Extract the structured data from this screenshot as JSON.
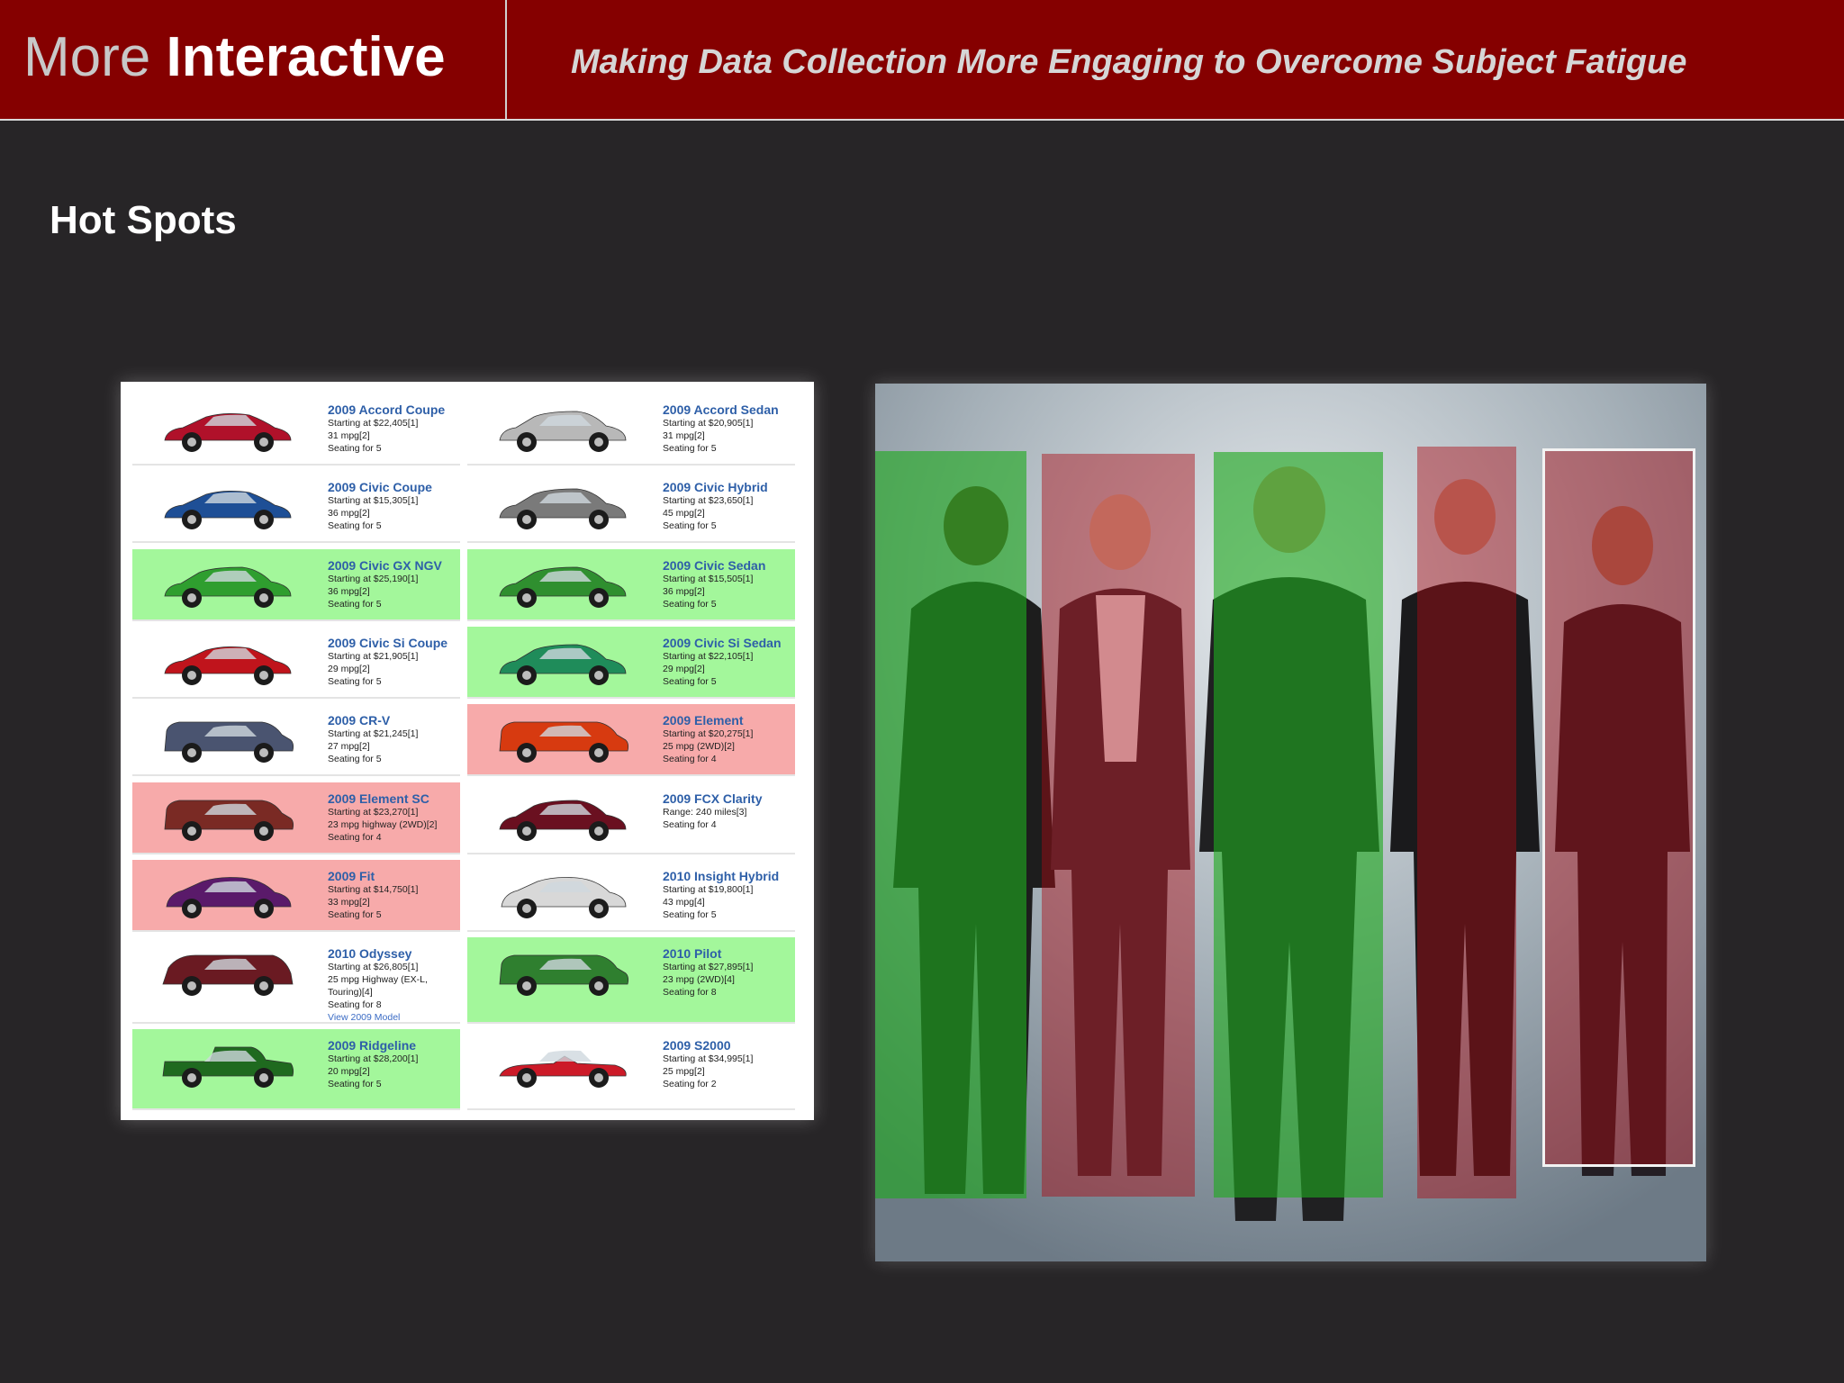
{
  "header": {
    "title_light": "More",
    "title_bold": "Interactive",
    "subtitle": "Making Data Collection More Engaging to Overcome Subject Fatigue"
  },
  "section_title": "Hot Spots",
  "colors": {
    "header_bg": "#850000",
    "page_bg": "#272527",
    "hotspot_green": "#2eaa2e",
    "hotspot_red": "#aa0a14"
  },
  "catalog": {
    "cars": [
      {
        "name": "2009 Accord Coupe",
        "lines": [
          "Starting at $22,405[1]",
          "31 mpg[2]",
          "Seating for 5"
        ],
        "state": "none",
        "color": "#b0112a",
        "type": "coupe"
      },
      {
        "name": "2009 Accord Sedan",
        "lines": [
          "Starting at $20,905[1]",
          "31 mpg[2]",
          "Seating for 5"
        ],
        "state": "none",
        "color": "#b8b8b8",
        "type": "sedan"
      },
      {
        "name": "2009 Civic Coupe",
        "lines": [
          "Starting at $15,305[1]",
          "36 mpg[2]",
          "Seating for 5"
        ],
        "state": "none",
        "color": "#1e4f96",
        "type": "coupe"
      },
      {
        "name": "2009 Civic Hybrid",
        "lines": [
          "Starting at $23,650[1]",
          "45 mpg[2]",
          "Seating for 5"
        ],
        "state": "none",
        "color": "#7a7a7a",
        "type": "sedan"
      },
      {
        "name": "2009 Civic GX NGV",
        "lines": [
          "Starting at $25,190[1]",
          "36 mpg[2]",
          "Seating for 5"
        ],
        "state": "green",
        "color": "#2f9e2f",
        "type": "sedan"
      },
      {
        "name": "2009 Civic Sedan",
        "lines": [
          "Starting at $15,505[1]",
          "36 mpg[2]",
          "Seating for 5"
        ],
        "state": "green",
        "color": "#2f8f2f",
        "type": "sedan"
      },
      {
        "name": "2009 Civic Si Coupe",
        "lines": [
          "Starting at $21,905[1]",
          "29 mpg[2]",
          "Seating for 5"
        ],
        "state": "none",
        "color": "#c0141c",
        "type": "coupe"
      },
      {
        "name": "2009 Civic Si Sedan",
        "lines": [
          "Starting at $22,105[1]",
          "29 mpg[2]",
          "Seating for 5"
        ],
        "state": "green",
        "color": "#1f8c5a",
        "type": "sedan"
      },
      {
        "name": "2009 CR-V",
        "lines": [
          "Starting at $21,245[1]",
          "27 mpg[2]",
          "Seating for 5"
        ],
        "state": "none",
        "color": "#4a5470",
        "type": "suv"
      },
      {
        "name": "2009 Element",
        "lines": [
          "Starting at $20,275[1]",
          "25 mpg (2WD)[2]",
          "Seating for 4"
        ],
        "state": "red",
        "color": "#d73a10",
        "type": "box"
      },
      {
        "name": "2009 Element SC",
        "lines": [
          "Starting at $23,270[1]",
          "23 mpg highway (2WD)[2]",
          "Seating for 4"
        ],
        "state": "red",
        "color": "#7a2a24",
        "type": "box"
      },
      {
        "name": "2009 FCX Clarity",
        "lines": [
          "Range: 240 miles[3]",
          "Seating for 4"
        ],
        "state": "none",
        "color": "#6a1020",
        "type": "sedan"
      },
      {
        "name": "2009 Fit",
        "lines": [
          "Starting at $14,750[1]",
          "33 mpg[2]",
          "Seating for 5"
        ],
        "state": "red",
        "color": "#5a1a6a",
        "type": "hatch"
      },
      {
        "name": "2010 Insight Hybrid",
        "lines": [
          "Starting at $19,800[1]",
          "43 mpg[4]",
          "Seating for 5"
        ],
        "state": "none",
        "color": "#d8d8d8",
        "type": "hatch"
      },
      {
        "name": "2010 Odyssey",
        "lines": [
          "Starting at $26,805[1]",
          "25 mpg Highway (EX-L,",
          "Touring)[4]",
          "Seating for 8"
        ],
        "link": "View 2009 Model",
        "state": "none",
        "color": "#6a1a22",
        "type": "van"
      },
      {
        "name": "2010 Pilot",
        "lines": [
          "Starting at $27,895[1]",
          "23 mpg (2WD)[4]",
          "Seating for 8"
        ],
        "state": "green",
        "color": "#2f7f2f",
        "type": "suv"
      },
      {
        "name": "2009 Ridgeline",
        "lines": [
          "Starting at $28,200[1]",
          "20 mpg[2]",
          "Seating for 5"
        ],
        "state": "green",
        "color": "#1f6a1f",
        "type": "truck"
      },
      {
        "name": "2009 S2000",
        "lines": [
          "Starting at $34,995[1]",
          "25 mpg[2]",
          "Seating for 2"
        ],
        "state": "none",
        "color": "#cc1a28",
        "type": "roadster"
      }
    ]
  },
  "photo": {
    "hotspots": [
      {
        "state": "green",
        "selected": false
      },
      {
        "state": "red",
        "selected": false
      },
      {
        "state": "green",
        "selected": false
      },
      {
        "state": "red",
        "selected": false
      },
      {
        "state": "red",
        "selected": true
      }
    ]
  }
}
